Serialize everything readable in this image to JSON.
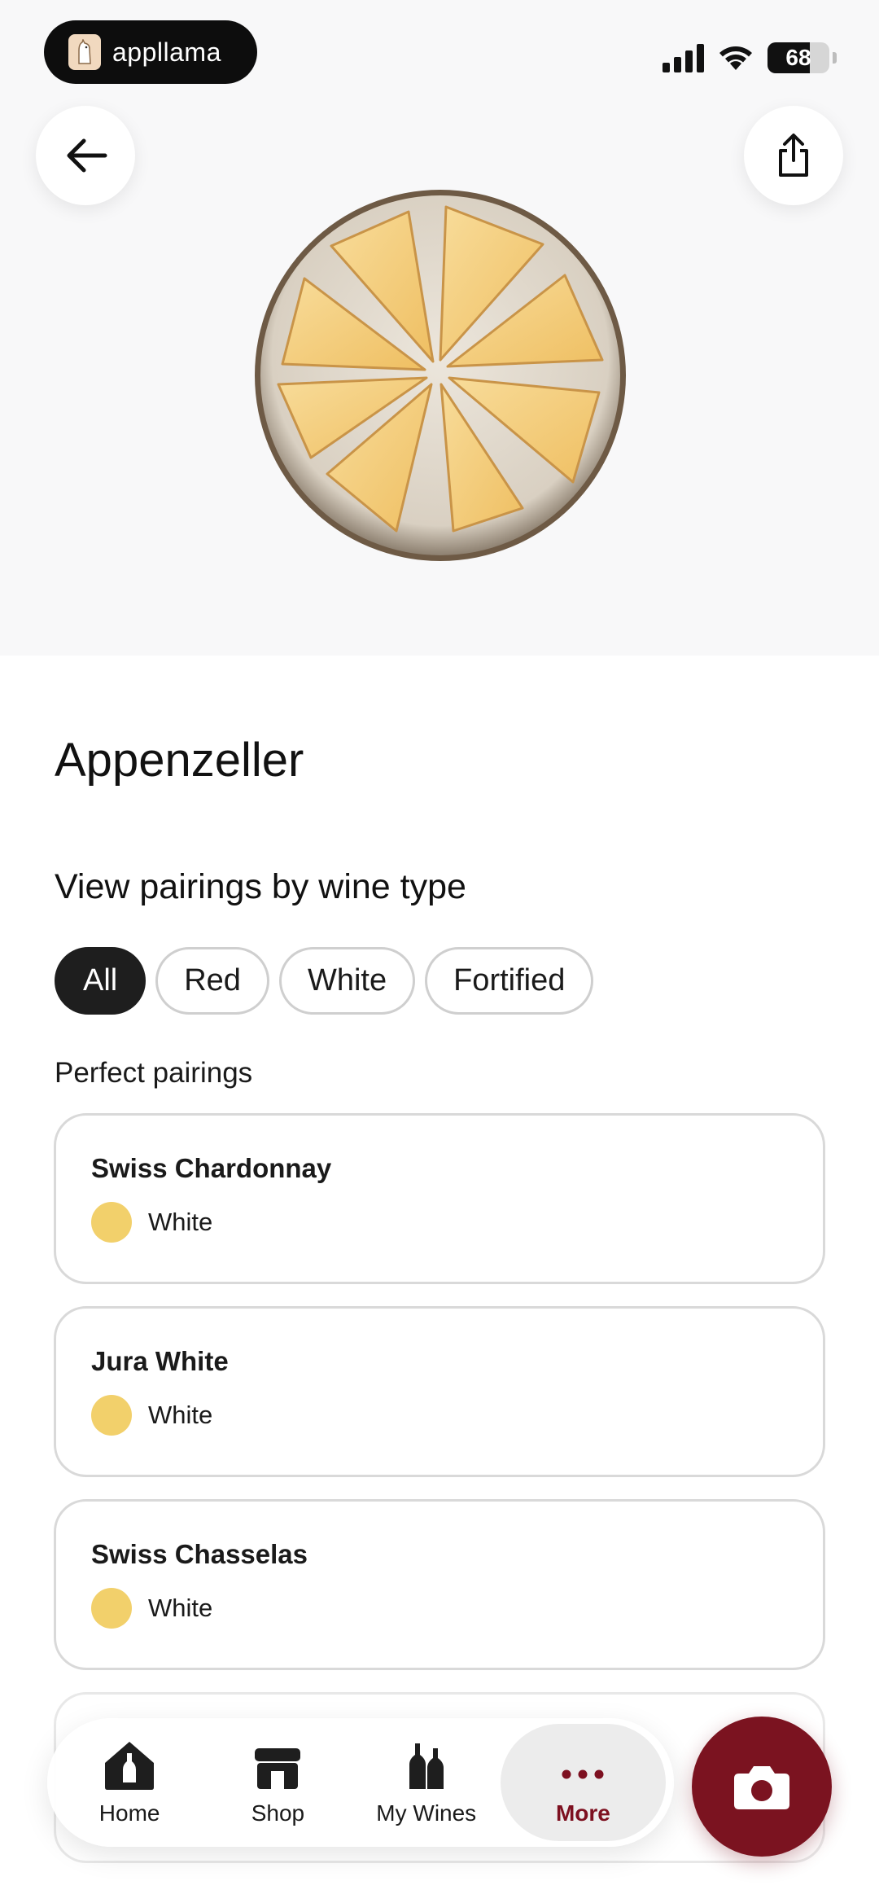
{
  "status_bar": {
    "recorder_badge": "appllama",
    "battery_level": "68"
  },
  "header": {
    "back_icon": "arrow-left-icon",
    "share_icon": "share-icon",
    "hero_image": "cheese-plate-image"
  },
  "cheese": {
    "name": "Appenzeller"
  },
  "filter": {
    "heading": "View pairings by wine type",
    "chips": [
      "All",
      "Red",
      "White",
      "Fortified"
    ],
    "selected": "All"
  },
  "pairings": {
    "section_label": "Perfect pairings",
    "items": [
      {
        "name": "Swiss Chardonnay",
        "type": "White",
        "color": "#f2d06b"
      },
      {
        "name": "Jura White",
        "type": "White",
        "color": "#f2d06b"
      },
      {
        "name": "Swiss Chasselas",
        "type": "White",
        "color": "#f2d06b"
      }
    ]
  },
  "tabbar": {
    "tabs": [
      {
        "label": "Home",
        "icon": "home-bottle-icon"
      },
      {
        "label": "Shop",
        "icon": "shop-icon"
      },
      {
        "label": "My Wines",
        "icon": "bottles-icon"
      },
      {
        "label": "More",
        "icon": "more-dots-icon"
      }
    ],
    "active": "More"
  },
  "fab": {
    "icon": "camera-icon"
  },
  "colors": {
    "accent": "#7b1320",
    "white_wine_dot": "#f2d06b",
    "chip_active": "#1e1e1e"
  }
}
